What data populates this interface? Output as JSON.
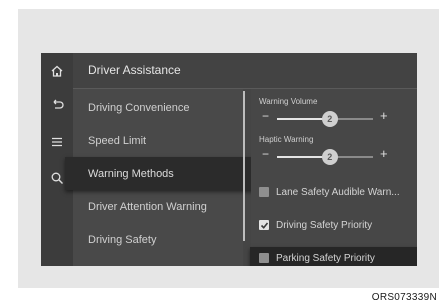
{
  "header": {
    "title": "Driver Assistance"
  },
  "sidebar_icons": [
    "home-icon",
    "back-icon",
    "menu-icon",
    "search-icon"
  ],
  "menu": {
    "items": [
      {
        "label": "Driving Convenience",
        "selected": false
      },
      {
        "label": "Speed Limit",
        "selected": false
      },
      {
        "label": "Warning Methods",
        "selected": true
      },
      {
        "label": "Driver Attention Warning",
        "selected": false
      },
      {
        "label": "Driving Safety",
        "selected": false
      }
    ]
  },
  "settings": {
    "warning_volume": {
      "label": "Warning Volume",
      "value": "2",
      "level": 0.55
    },
    "haptic_warning": {
      "label": "Haptic Warning",
      "value": "2",
      "level": 0.55
    },
    "minus_symbol": "−",
    "plus_symbol": "+",
    "options": [
      {
        "label": "Lane Safety Audible Warn...",
        "checked": false,
        "selected": false
      },
      {
        "label": "Driving Safety Priority",
        "checked": true,
        "selected": false
      },
      {
        "label": "Parking Safety Priority",
        "checked": false,
        "selected": true
      }
    ]
  },
  "caption": "ORS073339N",
  "colors": {
    "screen_bg": "#454545",
    "selected_bg": "#2b2b2b",
    "text": "#d0d0d0"
  }
}
